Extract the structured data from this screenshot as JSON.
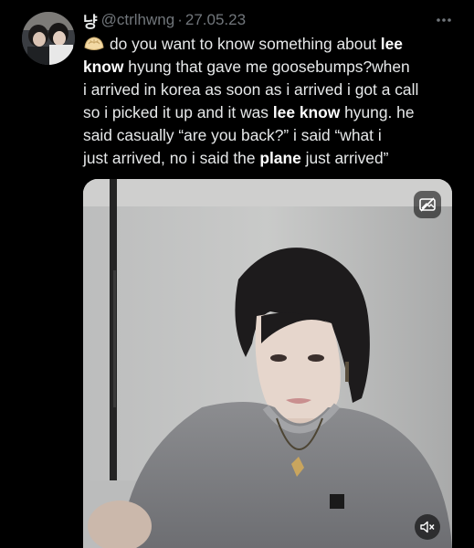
{
  "author": {
    "display_name": "냥",
    "handle": "@ctrlhwng",
    "separator": "·",
    "date": "27.05.23"
  },
  "tweet": {
    "emoji": "dumpling-emoji",
    "lines": [
      [
        {
          "t": "do you want to know something about "
        },
        {
          "t": "lee",
          "b": true
        }
      ],
      [
        {
          "t": "know",
          "b": true
        },
        {
          "t": " hyung that gave me goosebumps?when"
        }
      ],
      [
        {
          "t": "i arrived in korea as soon as i arrived i got a call"
        }
      ],
      [
        {
          "t": "so i picked it up and it was "
        },
        {
          "t": "lee know",
          "b": true
        },
        {
          "t": " hyung. he"
        }
      ],
      [
        {
          "t": "said casually “are you back?” i said “what i"
        }
      ],
      [
        {
          "t": "just arrived, no i said the "
        },
        {
          "t": "plane",
          "b": true
        },
        {
          "t": " just arrived”"
        }
      ]
    ]
  },
  "media": {
    "type": "video",
    "top_button_icon": "sensitive-media-icon",
    "mute_icon": "speaker-muted-icon"
  },
  "colors": {
    "background": "#000000",
    "text": "#e7e9ea",
    "muted": "#71767b"
  }
}
